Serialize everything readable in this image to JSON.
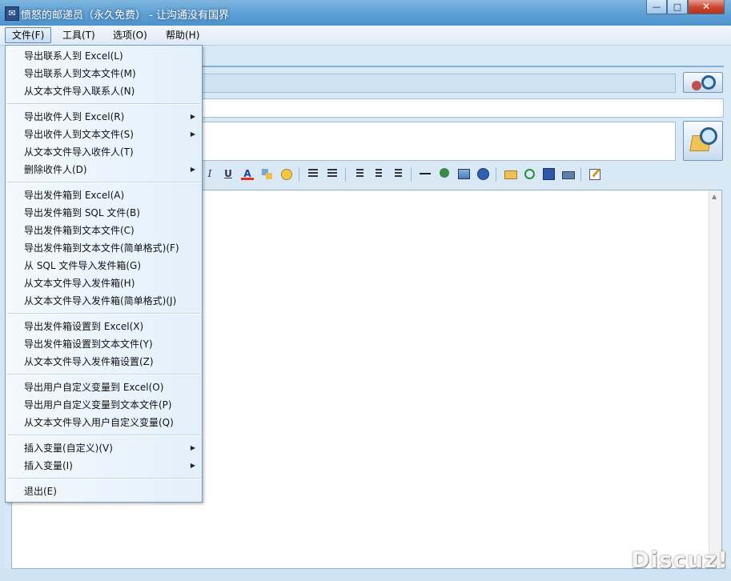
{
  "window": {
    "title": "愤怒的邮递员（永久免费） - 让沟通没有国界",
    "app_icon": "envelope-icon",
    "minimize_label": "—",
    "maximize_label": "□",
    "close_label": "✕"
  },
  "menubar": {
    "items": [
      {
        "label": "文件(F)"
      },
      {
        "label": "工具(T)"
      },
      {
        "label": "选项(O)"
      },
      {
        "label": "帮助(H)"
      }
    ]
  },
  "file_menu": {
    "groups": [
      [
        {
          "label": "导出联系人到 Excel(L)",
          "submenu": false
        },
        {
          "label": "导出联系人到文本文件(M)",
          "submenu": false
        },
        {
          "label": "从文本文件导入联系人(N)",
          "submenu": false
        }
      ],
      [
        {
          "label": "导出收件人到 Excel(R)",
          "submenu": true
        },
        {
          "label": "导出收件人到文本文件(S)",
          "submenu": true
        },
        {
          "label": "从文本文件导入收件人(T)",
          "submenu": false
        },
        {
          "label": "删除收件人(D)",
          "submenu": true
        }
      ],
      [
        {
          "label": "导出发件箱到 Excel(A)",
          "submenu": false
        },
        {
          "label": "导出发件箱到 SQL 文件(B)",
          "submenu": false
        },
        {
          "label": "导出发件箱到文本文件(C)",
          "submenu": false
        },
        {
          "label": "导出发件箱到文本文件(简单格式)(F)",
          "submenu": false
        },
        {
          "label": "从 SQL 文件导入发件箱(G)",
          "submenu": false
        },
        {
          "label": "从文本文件导入发件箱(H)",
          "submenu": false
        },
        {
          "label": "从文本文件导入发件箱(简单格式)(J)",
          "submenu": false
        }
      ],
      [
        {
          "label": "导出发件箱设置到 Excel(X)",
          "submenu": false
        },
        {
          "label": "导出发件箱设置到文本文件(Y)",
          "submenu": false
        },
        {
          "label": "从文本文件导入发件箱设置(Z)",
          "submenu": false
        }
      ],
      [
        {
          "label": "导出用户自定义变量到 Excel(O)",
          "submenu": false
        },
        {
          "label": "导出用户自定义变量到文本文件(P)",
          "submenu": false
        },
        {
          "label": "从文本文件导入用户自定义变量(Q)",
          "submenu": false
        }
      ],
      [
        {
          "label": "插入变量(自定义)(V)",
          "submenu": true
        },
        {
          "label": "插入变量(I)",
          "submenu": true
        }
      ],
      [
        {
          "label": "退出(E)",
          "submenu": false
        }
      ]
    ],
    "submenu_arrow": "▶"
  },
  "toolbar": {
    "icons": [
      "italic-icon",
      "underline-icon",
      "font-color-icon",
      "highlight-icon",
      "emoji-icon",
      "indent-icon",
      "outdent-icon",
      "align-left-icon",
      "align-center-icon",
      "align-right-icon",
      "horizontal-rule-icon",
      "insert-link-icon",
      "insert-image-icon",
      "insert-flash-icon",
      "open-folder-icon",
      "preview-icon",
      "save-icon",
      "print-icon",
      "edit-icon"
    ],
    "italic_glyph": "I",
    "underline_glyph": "U",
    "font_color_glyph": "A"
  },
  "watermark": "Discuz!"
}
